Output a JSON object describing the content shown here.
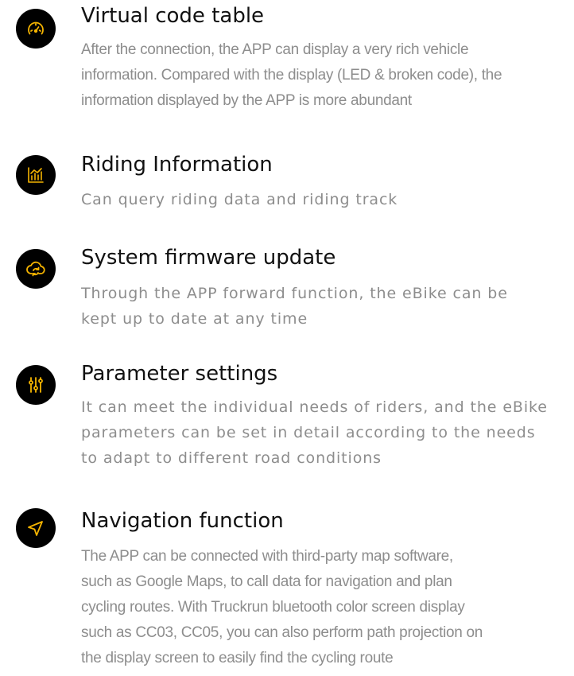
{
  "colors": {
    "icon_background": "#000000",
    "icon_foreground": "#f5b400",
    "title_text": "#111111",
    "description_text": "#8d8d8d"
  },
  "features": [
    {
      "icon": "speedometer-icon",
      "title": "Virtual code table",
      "description_lines": [
        "After the connection, the APP can display a very rich vehicle",
        "information. Compared with the display (LED & broken code), the",
        "information displayed by the APP is more abundant"
      ]
    },
    {
      "icon": "chart-icon",
      "title": "Riding Information",
      "description_lines": [
        "Can query riding data and riding track"
      ]
    },
    {
      "icon": "cloud-sync-icon",
      "title": "System firmware update",
      "description_lines": [
        "Through the APP forward function, the eBike can be",
        "kept up to date at any time"
      ]
    },
    {
      "icon": "sliders-icon",
      "title": "Parameter settings",
      "description_lines": [
        "It can meet the individual needs of riders, and the eBike",
        "parameters can be set in detail according to the needs",
        "to adapt to different road conditions"
      ]
    },
    {
      "icon": "navigation-arrow-icon",
      "title": "Navigation function",
      "description_lines": [
        "The APP can be connected with third-party map software,",
        "such as Google Maps, to call data for navigation and plan",
        "cycling routes. With Truckrun bluetooth color screen display",
        "such as CC03, CC05, you can also perform path projection on",
        "the display screen to easily find the cycling route"
      ]
    }
  ]
}
